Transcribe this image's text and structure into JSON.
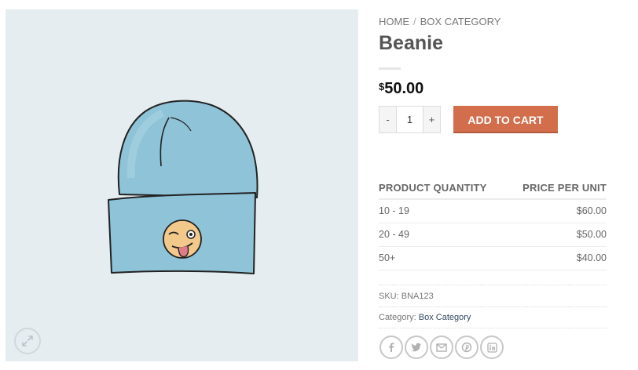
{
  "breadcrumb": {
    "home": "Home",
    "separator": "/",
    "category": "Box Category"
  },
  "product": {
    "title": "Beanie",
    "price_symbol": "$",
    "price_amount": "50.00",
    "quantity": "1",
    "qty_minus": "-",
    "qty_plus": "+",
    "add_to_cart": "Add to cart",
    "image_icon": "beanie-winking-emoji-image"
  },
  "tiers": {
    "headers": [
      "Product Quantity",
      "Price per unit"
    ],
    "rows": [
      {
        "qty": "10 - 19",
        "price": "$60.00"
      },
      {
        "qty": "20 - 49",
        "price": "$50.00"
      },
      {
        "qty": "50+",
        "price": "$40.00"
      }
    ]
  },
  "meta": {
    "sku_label": "SKU:",
    "sku_value": "BNA123",
    "category_label": "Category:",
    "category_value": "Box Category"
  },
  "share_icons": [
    "facebook-icon",
    "twitter-icon",
    "email-icon",
    "pinterest-icon",
    "linkedin-icon"
  ],
  "colors": {
    "accent": "#d26e4b",
    "image_background": "#e5edf1",
    "beanie": "#8fc3d8",
    "link": "#334862"
  }
}
